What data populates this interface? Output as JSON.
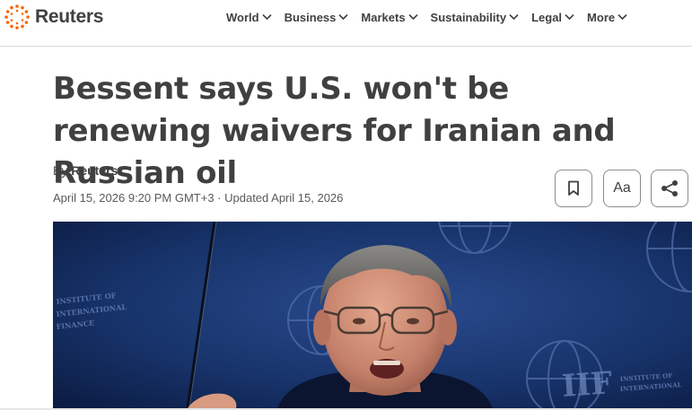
{
  "brand": {
    "name": "Reuters",
    "logo_icon": "reuters-dot-logo-icon",
    "accent": "#fa6400"
  },
  "nav": {
    "items": [
      {
        "label": "World"
      },
      {
        "label": "Business"
      },
      {
        "label": "Markets"
      },
      {
        "label": "Sustainability"
      },
      {
        "label": "Legal"
      },
      {
        "label": "More"
      }
    ],
    "chevron_icon": "chevron-down-icon"
  },
  "article": {
    "headline": "Bessent says U.S. won't be renewing waivers for Iranian and Russian oil",
    "by_prefix": "By",
    "author": "Reuters",
    "dateline": "April 15, 2026 9:20 PM GMT+3 · Updated April 15, 2026"
  },
  "actions": {
    "save_icon": "bookmark-icon",
    "font_label": "Aa",
    "share_icon": "share-icon"
  },
  "photo": {
    "backdrop_text": "INSTITUTE OF INTERNATIONAL FINANCE",
    "backdrop_logo": "IIF"
  }
}
